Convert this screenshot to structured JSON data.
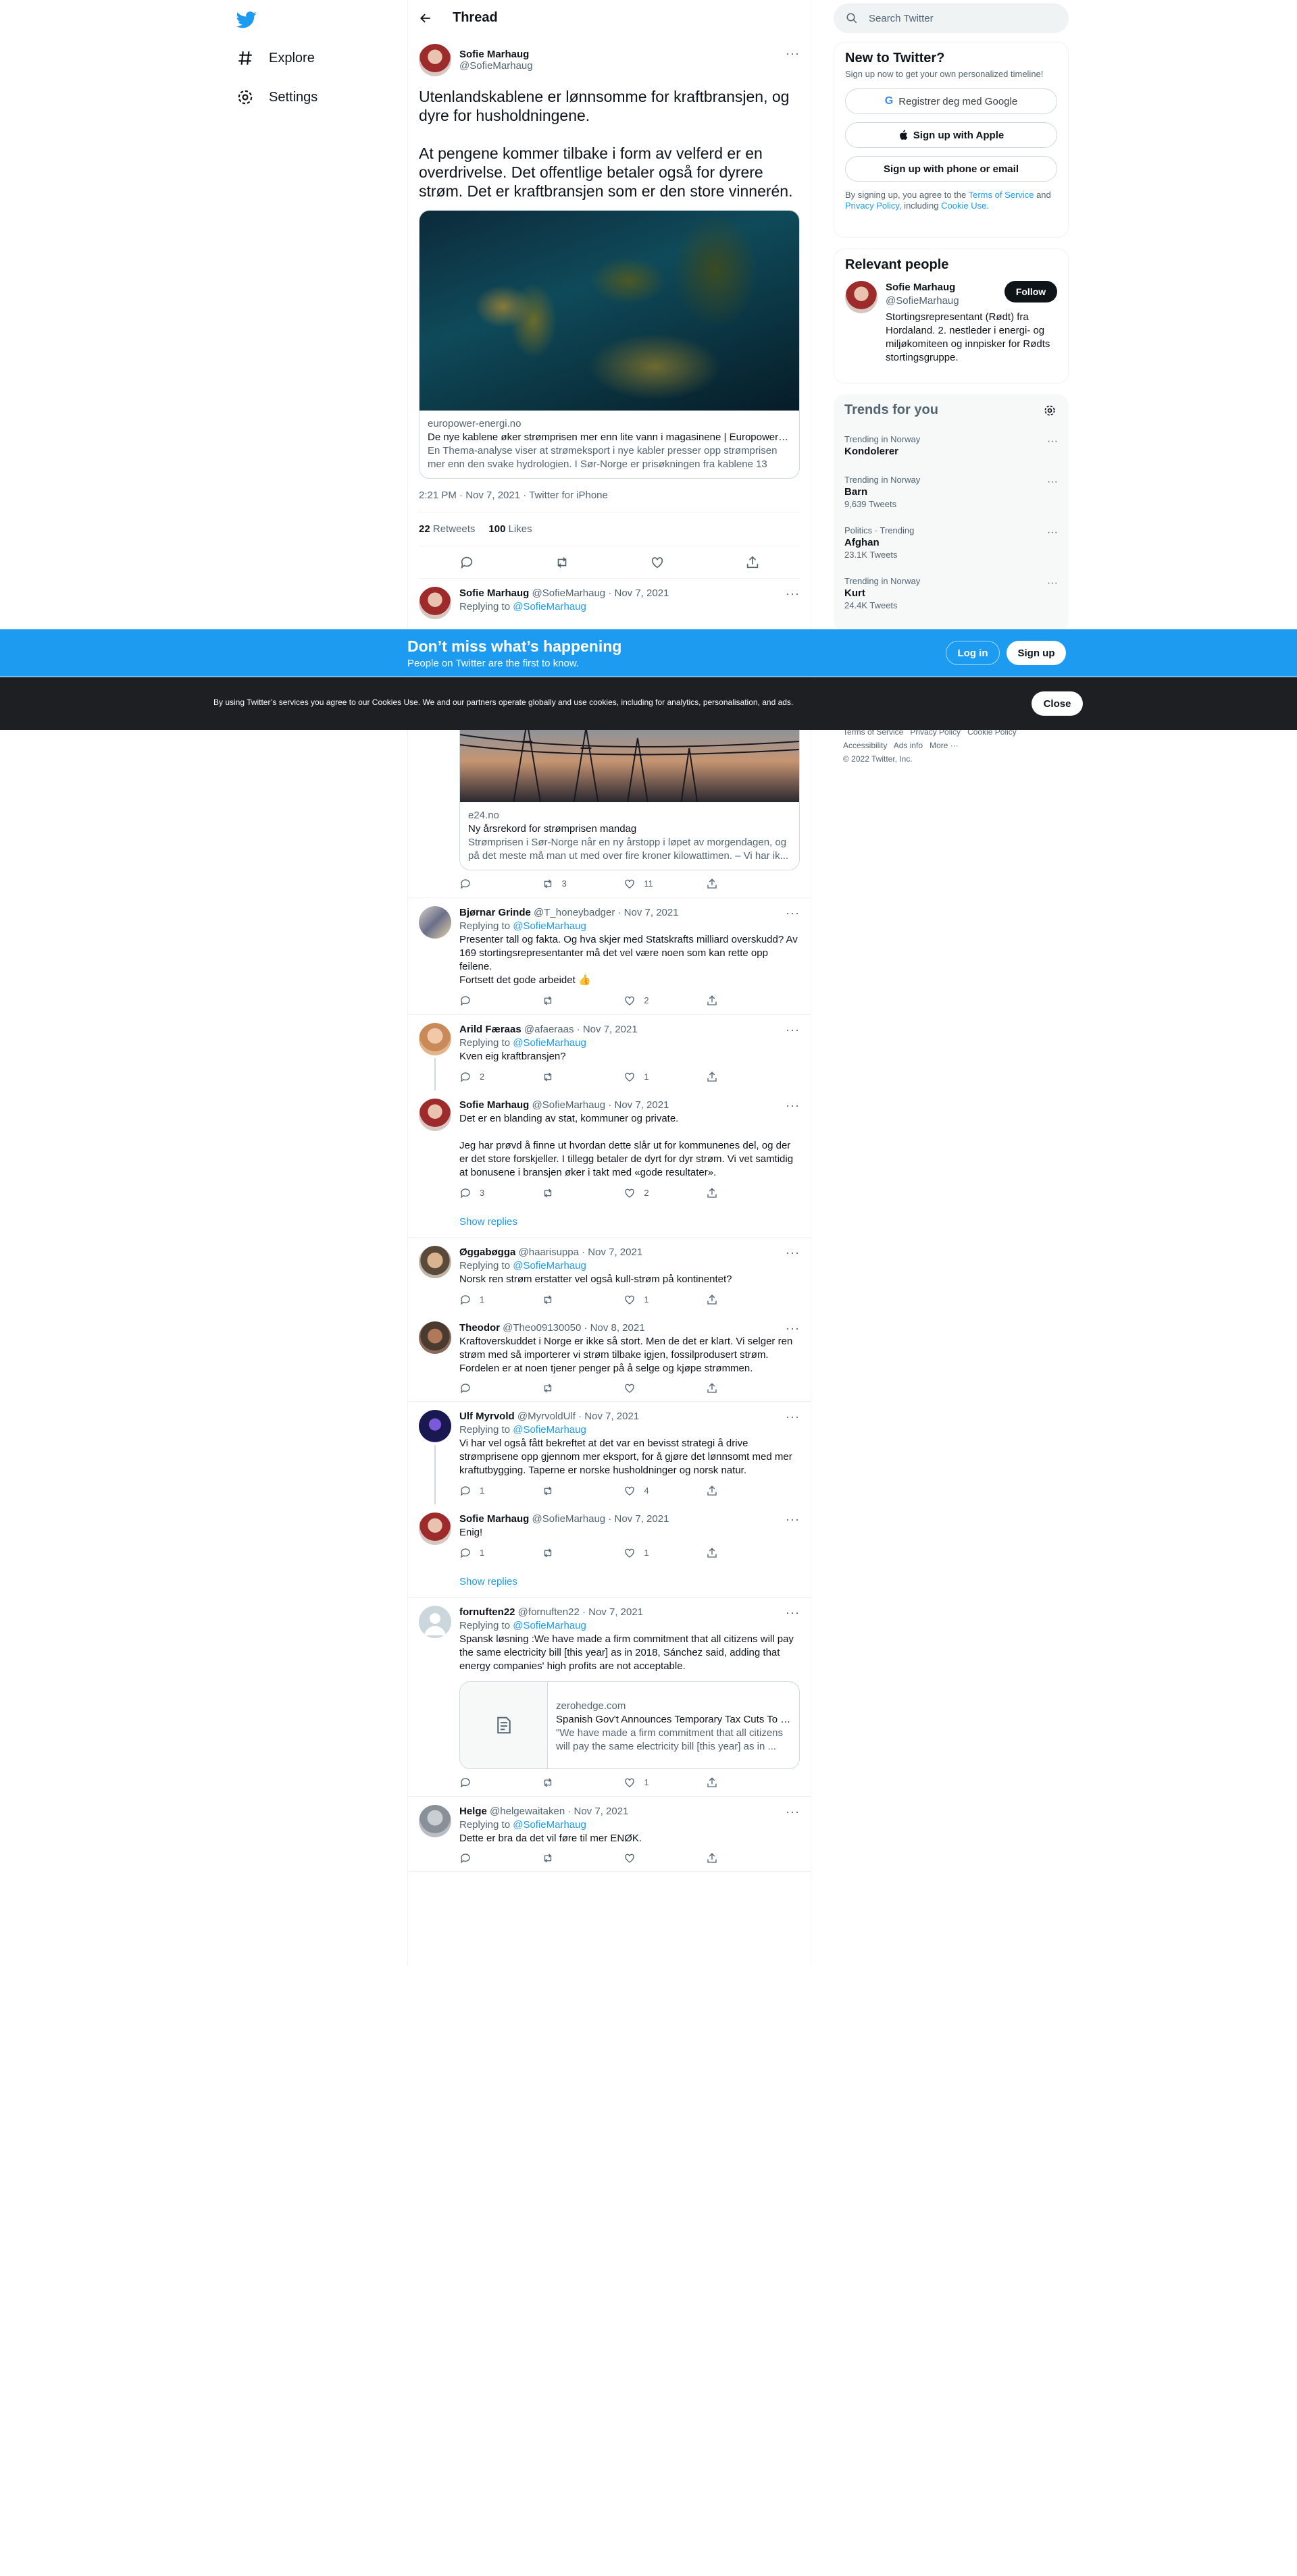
{
  "nav": {
    "explore": "Explore",
    "settings": "Settings"
  },
  "header": {
    "title": "Thread"
  },
  "main_tweet": {
    "name": "Sofie Marhaug",
    "handle": "@SofieMarhaug",
    "text": "Utenlandskablene er lønnsomme for kraftbransjen, og dyre for husholdningene.\n\nAt pengene kommer tilbake i form av velferd er en overdrivelse. Det offentlige betaler også for dyrere strøm. Det er kraftbransjen som er den store vinnerén.",
    "card": {
      "domain": "europower-energi.no",
      "title": "De nye kablene øker strømprisen mer enn lite vann i magasinene | Europower En...",
      "description": "En Thema-analyse viser at strømeksport i nye kabler presser opp strømprisen mer enn den svake hydrologien. I Sør-Norge er prisøkningen fra kablene 13 øre/kWh."
    },
    "meta": "2:21 PM · Nov 7, 2021 · Twitter for iPhone",
    "retweets": "22",
    "retweets_label": "Retweets",
    "likes": "100",
    "likes_label": "Likes"
  },
  "replies": [
    {
      "name": "Sofie Marhaug",
      "handle": "@SofieMarhaug",
      "date": "· Nov 7, 2021",
      "replying": "Replying to",
      "to": "@SofieMarhaug",
      "card": {
        "domain": "e24.no",
        "title": "Ny årsrekord for strømprisen mandag",
        "description": "Strømprisen i Sør-Norge når en ny årstopp i løpet av morgendagen, og på det meste må man ut med over fire kroner kilowattimen. – Vi har ik..."
      },
      "retweets": "3",
      "likes": "11"
    },
    {
      "name": "Bjørnar Grinde",
      "handle": "@T_honeybadger",
      "date": "· Nov 7, 2021",
      "replying": "Replying to",
      "to": "@SofieMarhaug",
      "text": "Presenter tall og fakta. Og hva skjer med Statskrafts milliard overskudd? Av 169 stortingsrepresentanter må det vel være noen som kan rette opp feilene.\nFortsett det gode arbeidet 👍",
      "likes": "2"
    },
    {
      "name": "Arild Færaas",
      "handle": "@afaeraas",
      "date": "· Nov 7, 2021",
      "replying": "Replying to",
      "to": "@SofieMarhaug",
      "text": "Kven eig kraftbransjen?",
      "replies": "2",
      "likes": "1"
    },
    {
      "name": "Sofie Marhaug",
      "handle": "@SofieMarhaug",
      "date": "· Nov 7, 2021",
      "text": "Det er en blanding av stat, kommuner og private.\n\nJeg har prøvd å finne ut hvordan dette slår ut for kommunenes del, og der er det store forskjeller. I tillegg betaler de dyrt for dyr strøm. Vi vet samtidig at bonusene i bransjen øker i takt med «gode resultater».",
      "replies": "3",
      "likes": "2"
    },
    {
      "name": "Øggabøgga",
      "handle": "@haarisuppa",
      "date": "· Nov 7, 2021",
      "replying": "Replying to",
      "to": "@SofieMarhaug",
      "text": "Norsk ren strøm erstatter vel også kull-strøm på kontinentet?",
      "replies": "1",
      "likes": "1"
    },
    {
      "name": "Theodor",
      "handle": "@Theo09130050",
      "date": "· Nov 8, 2021",
      "text": "Kraftoverskuddet i Norge er ikke så stort. Men de det er klart. Vi selger ren strøm med så importerer vi strøm tilbake igjen, fossilprodusert strøm. Fordelen er at noen tjener penger på å selge og kjøpe strømmen."
    },
    {
      "name": "Ulf Myrvold",
      "handle": "@MyrvoldUlf",
      "date": "· Nov 7, 2021",
      "replying": "Replying to",
      "to": "@SofieMarhaug",
      "text": "Vi har vel også fått bekreftet at det var en bevisst strategi å drive strømprisene opp gjennom mer eksport, for å gjøre det lønnsomt med mer kraftutbygging. Taperne er norske husholdninger og norsk natur.",
      "replies": "1",
      "likes": "4"
    },
    {
      "name": "Sofie Marhaug",
      "handle": "@SofieMarhaug",
      "date": "· Nov 7, 2021",
      "text": "Enig!",
      "replies": "1",
      "likes": "1"
    },
    {
      "name": "fornuften22",
      "handle": "@fornuften22",
      "date": "· Nov 7, 2021",
      "replying": "Replying to",
      "to": "@SofieMarhaug",
      "text": "Spansk løsning :We have made a firm commitment that all citizens will pay the same electricity bill [this year] as in 2018, Sánchez said, adding that energy companies' high profits are not acceptable.",
      "card": {
        "domain": "zerohedge.com",
        "title": "Spanish Gov't Announces Temporary Tax Cuts To R...",
        "description": "\"We have made a firm commitment that all citizens will pay the same electricity bill [this year] as in ..."
      },
      "likes": "1"
    },
    {
      "name": "Helge",
      "handle": "@helgewaitaken",
      "date": "· Nov 7, 2021",
      "replying": "Replying to",
      "to": "@SofieMarhaug",
      "text": "Dette er bra da det vil føre til mer ENØK."
    }
  ],
  "show_replies": "Show replies",
  "search": {
    "placeholder": "Search Twitter"
  },
  "signup": {
    "title": "New to Twitter?",
    "subtitle": "Sign up now to get your own personalized timeline!",
    "google": "Registrer deg med Google",
    "apple": "Sign up with Apple",
    "phone": "Sign up with phone or email",
    "terms_pre": "By signing up, you agree to the",
    "terms": "Terms of Service",
    "and": "and",
    "privacy": "Privacy Policy",
    "including": ", including",
    "cookie": "Cookie Use."
  },
  "relevant": {
    "title": "Relevant people",
    "name": "Sofie Marhaug",
    "handle": "@SofieMarhaug",
    "follow": "Follow",
    "bio": "Stortingsrepresentant (Rødt) fra Hordaland. 2. nestleder i energi- og miljøkomiteen og innpisker for Rødts stortingsgruppe."
  },
  "trends": {
    "title": "Trends for you",
    "items": [
      {
        "context": "Trending in Norway",
        "name": "Kondolerer",
        "count": ""
      },
      {
        "context": "Trending in Norway",
        "name": "Barn",
        "count": "9,639 Tweets"
      },
      {
        "context": "Politics · Trending",
        "name": "Afghan",
        "count": "23.1K Tweets"
      },
      {
        "context": "Trending in Norway",
        "name": "Kurt",
        "count": "24.4K Tweets"
      }
    ]
  },
  "footer": {
    "terms": "Terms of Service",
    "privacy": "Privacy Policy",
    "cookie": "Cookie Policy",
    "accessibility": "Accessibility",
    "ads": "Ads info",
    "more": "More ···",
    "copyright": "© 2022 Twitter, Inc."
  },
  "banner": {
    "title": "Don’t miss what’s happening",
    "subtitle": "People on Twitter are the first to know.",
    "login": "Log in",
    "signup": "Sign up"
  },
  "cookie": {
    "text": "By using Twitter’s services you agree to our Cookies Use. We and our partners operate globally and use cookies, including for analytics, personalisation, and ads.",
    "close": "Close"
  },
  "colors": {
    "accent": "#1d9bf0",
    "text": "#0f1419",
    "muted": "#536471",
    "cookie_bg": "#1d1f22"
  }
}
